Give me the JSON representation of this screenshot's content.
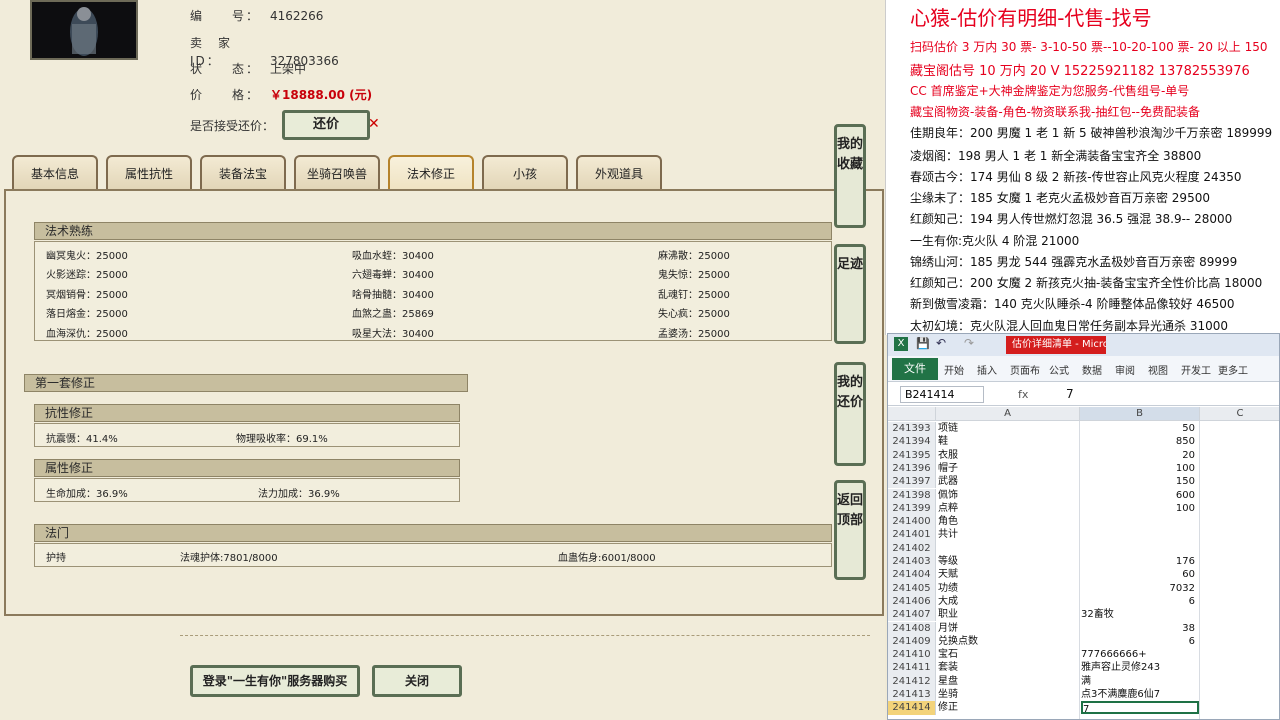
{
  "listing": {
    "id_label": "编　　号：",
    "id_value": "4162266",
    "seller_label": "卖　家　ID：",
    "seller_value": "327803366",
    "status_label": "状　　态：",
    "status_value": "上架中",
    "price_label": "价　　格：",
    "price_value": "￥18888.00 (元)",
    "counter_label": "是否接受还价：",
    "counter_button": "还价"
  },
  "tabs": [
    "基本信息",
    "属性抗性",
    "装备法宝",
    "坐骑召唤兽",
    "法术修正",
    "小孩",
    "外观道具"
  ],
  "active_tab": "法术修正",
  "skills": {
    "title": "法术熟练",
    "rows": [
      [
        "幽冥鬼火：25000",
        "吸血水蛭：30400",
        "麻沸散：25000"
      ],
      [
        "火影迷踪：25000",
        "六翅毒蝉：30400",
        "鬼失惊：25000"
      ],
      [
        "冥烟销骨：25000",
        "啥骨抽髓：30400",
        "乱魂钉：25000"
      ],
      [
        "落日熔金：25000",
        "血煞之蛊：25869",
        "失心疯：25000"
      ],
      [
        "血海深仇：25000",
        "吸星大法：30400",
        "孟婆汤：25000"
      ]
    ]
  },
  "first_set": {
    "title": "第一套修正",
    "resist_title": "抗性修正",
    "resist_items": [
      "抗震慑：41.4%",
      "物理吸收率：69.1%"
    ],
    "attr_title": "属性修正",
    "attr_items": [
      "生命加成：36.9%",
      "法力加成：36.9%"
    ]
  },
  "magic": {
    "title": "法门",
    "items": [
      "护持",
      "法魂护体:7801/8000",
      "血蛊佑身:6001/8000"
    ]
  },
  "side_buttons": [
    "我的收藏",
    "足迹",
    "我的还价",
    "返回顶部"
  ],
  "bottom_buttons": {
    "login_buy": "登录\"一生有你\"服务器购买",
    "close": "关闭"
  },
  "notes": {
    "title": "心猿-估价有明细-代售-找号",
    "lines": [
      {
        "text": "扫码估价 3 万内 30 票- 3-10-50 票--10-20-100 票- 20 以上 150",
        "color": "red"
      },
      {
        "text": "藏宝阁估号 10 万内 20 V 15225921182   13782553976",
        "color": "red"
      },
      {
        "text": "CC 首席鉴定+大神金牌鉴定为您服务-代售组号-单号",
        "color": "red"
      },
      {
        "text": "藏宝阁物资-装备-角色-物资联系我-抽红包--免费配装备",
        "color": "red"
      },
      {
        "text": "佳期良年：200 男魔 1 老 1 新 5 破神兽秒浪淘沙千万亲密 189999",
        "color": "black"
      },
      {
        "text": "凌烟阁：198 男人 1 老 1 新全满装备宝宝齐全 38800",
        "color": "black"
      },
      {
        "text": "春颂古今：174 男仙 8 级 2 新孩-传世容止风克火程度 24350",
        "color": "black"
      },
      {
        "text": "尘缘未了：185 女魔 1 老克火孟极妙音百万亲密 29500",
        "color": "black"
      },
      {
        "text": "红颜知己：194 男人传世燃灯忽混 36.5 强混 38.9-- 28000",
        "color": "black"
      },
      {
        "text": "一生有你:克火队 4 阶混 21000",
        "color": "black"
      },
      {
        "text": "锦绣山河：185 男龙 544 强霹克水孟极妙音百万亲密 89999",
        "color": "black"
      },
      {
        "text": "红颜知己：200 女魔 2 新孩克火抽-装备宝宝齐全性价比高 18000",
        "color": "black"
      },
      {
        "text": "新到傲雪凌霜：140 克火队睡杀-4 阶睡整体品像较好 46500",
        "color": "black"
      },
      {
        "text": "太初幻境：克火队混人回血鬼日常任务副本异光通杀 31000",
        "color": "black"
      }
    ]
  },
  "excel": {
    "title": "估价详细清单 - Microsoft Excel(产品...",
    "menus": [
      "开始",
      "插入",
      "页面布",
      "公式",
      "数据",
      "审阅",
      "视图",
      "开发工",
      "更多工"
    ],
    "file_tab": "文件",
    "name_box": "B241414",
    "fx": "fx",
    "formula_value": "7",
    "columns": [
      "A",
      "B",
      "C"
    ],
    "rows": [
      {
        "n": "241393",
        "a": "项链",
        "b": "50"
      },
      {
        "n": "241394",
        "a": "鞋",
        "b": "850"
      },
      {
        "n": "241395",
        "a": "衣服",
        "b": "20"
      },
      {
        "n": "241396",
        "a": "帽子",
        "b": "100"
      },
      {
        "n": "241397",
        "a": "武器",
        "b": "150"
      },
      {
        "n": "241398",
        "a": "佩饰",
        "b": "600"
      },
      {
        "n": "241399",
        "a": "点粹",
        "b": "100"
      },
      {
        "n": "241400",
        "a": "角色",
        "b": ""
      },
      {
        "n": "241401",
        "a": "共计",
        "b": ""
      },
      {
        "n": "241402",
        "a": "",
        "b": ""
      },
      {
        "n": "241403",
        "a": "等级",
        "b": "176"
      },
      {
        "n": "241404",
        "a": "天赋",
        "b": "60"
      },
      {
        "n": "241405",
        "a": "功绩",
        "b": "7032"
      },
      {
        "n": "241406",
        "a": "大成",
        "b": "6"
      },
      {
        "n": "241407",
        "a": "职业",
        "b": "32畜牧"
      },
      {
        "n": "241408",
        "a": "月饼",
        "b": "38"
      },
      {
        "n": "241409",
        "a": "兑换点数",
        "b": "6"
      },
      {
        "n": "241410",
        "a": "宝石",
        "b": "777666666+"
      },
      {
        "n": "241411",
        "a": "套装",
        "b": "雅声容止灵修243"
      },
      {
        "n": "241412",
        "a": "星盘",
        "b": "满"
      },
      {
        "n": "241413",
        "a": "坐骑",
        "b": "点3不满麋鹿6仙7"
      },
      {
        "n": "241414",
        "a": "修正",
        "b": "7"
      }
    ]
  }
}
